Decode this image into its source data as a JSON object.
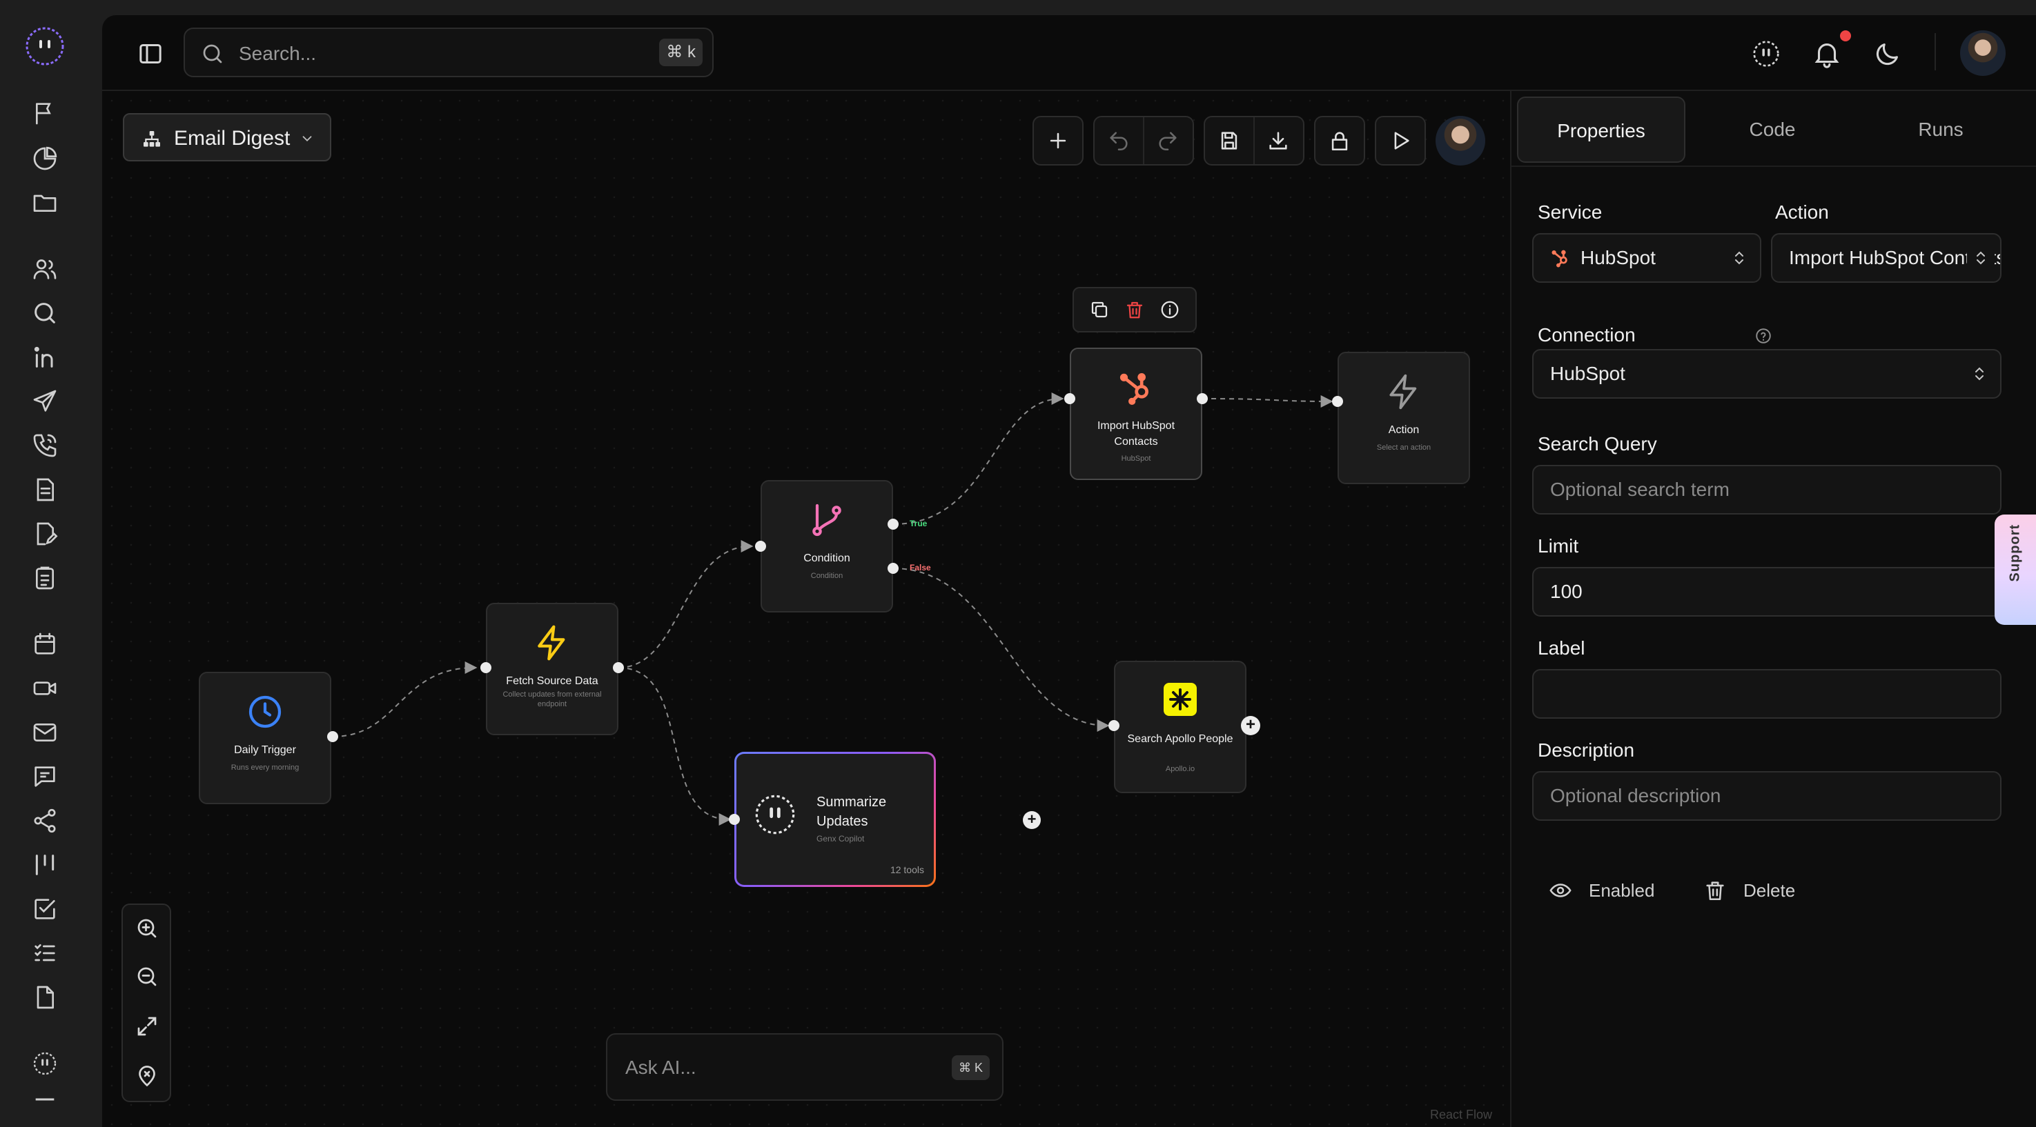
{
  "search": {
    "placeholder": "Search...",
    "shortcut": "⌘ k"
  },
  "workflow": {
    "name": "Email Digest"
  },
  "nodes": {
    "daily_trigger": {
      "title": "Daily Trigger",
      "subtitle": "Runs every morning"
    },
    "fetch_source": {
      "title": "Fetch Source Data",
      "subtitle": "Collect updates from external endpoint"
    },
    "condition": {
      "title": "Condition",
      "subtitle": "Condition",
      "true_label": "True",
      "false_label": "False"
    },
    "import_hubspot": {
      "title": "Import HubSpot Contacts",
      "subtitle": "HubSpot"
    },
    "action": {
      "title": "Action",
      "subtitle": "Select an action"
    },
    "search_apollo": {
      "title": "Search Apollo People",
      "subtitle": "Apollo.io"
    },
    "summarize": {
      "title": "Summarize Updates",
      "subtitle": "Genx Copilot",
      "tools": "12 tools"
    }
  },
  "ask_ai": {
    "placeholder": "Ask AI...",
    "shortcut": "⌘ K"
  },
  "attribution": "React Flow",
  "panel": {
    "tabs": [
      "Properties",
      "Code",
      "Runs"
    ],
    "service": {
      "label": "Service",
      "value": "HubSpot"
    },
    "action": {
      "label": "Action",
      "value": "Import HubSpot Contacts"
    },
    "connection": {
      "label": "Connection",
      "value": "HubSpot"
    },
    "search_query": {
      "label": "Search Query",
      "placeholder": "Optional search term"
    },
    "limit": {
      "label": "Limit",
      "value": "100"
    },
    "label_field": {
      "label": "Label",
      "value": ""
    },
    "description": {
      "label": "Description",
      "placeholder": "Optional description"
    },
    "enabled_label": "Enabled",
    "delete_label": "Delete"
  },
  "support_label": "Support",
  "colors": {
    "hubspot": "#ff7a59",
    "trigger_blue": "#3b82f6",
    "bolt_yellow": "#facc15",
    "condition_pink": "#f472b6",
    "true_green": "#4ade80",
    "false_red": "#f87171",
    "apollo_yellow": "#f5f100",
    "notification": "#ef4444"
  },
  "icons": {
    "rail": [
      "flag-icon",
      "pie-chart-icon",
      "folder-icon",
      "users-icon",
      "search-icon",
      "linkedin-icon",
      "send-icon",
      "phone-call-icon",
      "document-icon",
      "document-edit-icon",
      "clipboard-icon",
      "calendar-icon",
      "video-icon",
      "mail-icon",
      "message-icon",
      "share-icon",
      "columns-icon",
      "checkbox-icon",
      "list-check-icon",
      "file-icon",
      "brand-logo-icon"
    ],
    "canvas_toolbar": [
      "plus-icon",
      "undo-icon",
      "redo-icon",
      "save-icon",
      "download-icon",
      "lock-icon",
      "play-icon"
    ]
  }
}
